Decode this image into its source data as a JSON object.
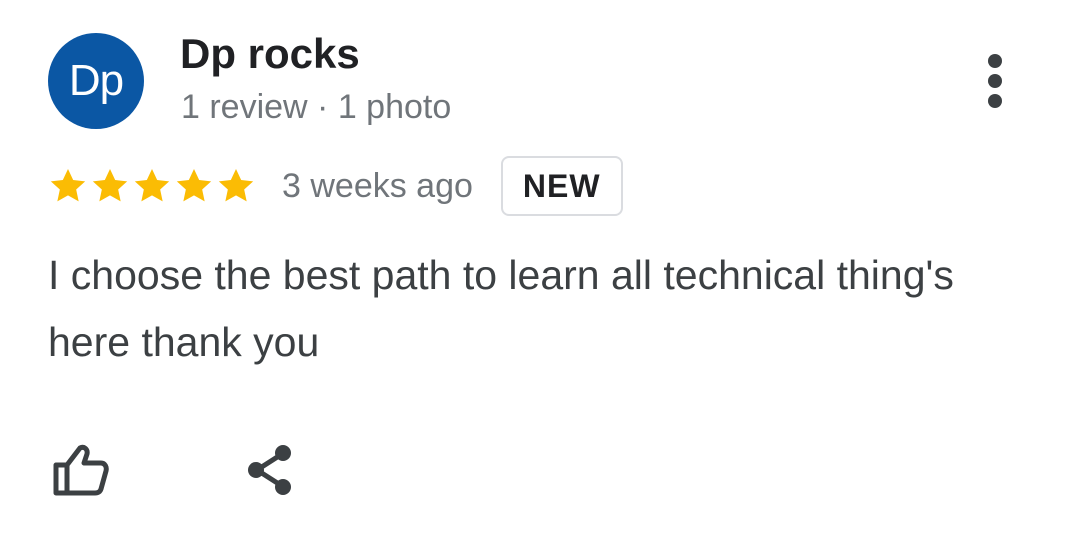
{
  "author": {
    "initials": "Dp",
    "name": "Dp rocks",
    "meta": "1 review · 1 photo",
    "avatar_color": "#0b57a4"
  },
  "menu": {
    "icon": "more-vert-icon"
  },
  "review": {
    "rating": 5,
    "rating_max": 5,
    "star_color": "#fbbc04",
    "time": "3 weeks ago",
    "badge": "NEW",
    "text": "I choose the best path to learn all technical thing's here thank you"
  },
  "actions": {
    "like_icon": "thumbs-up-icon",
    "share_icon": "share-icon"
  }
}
